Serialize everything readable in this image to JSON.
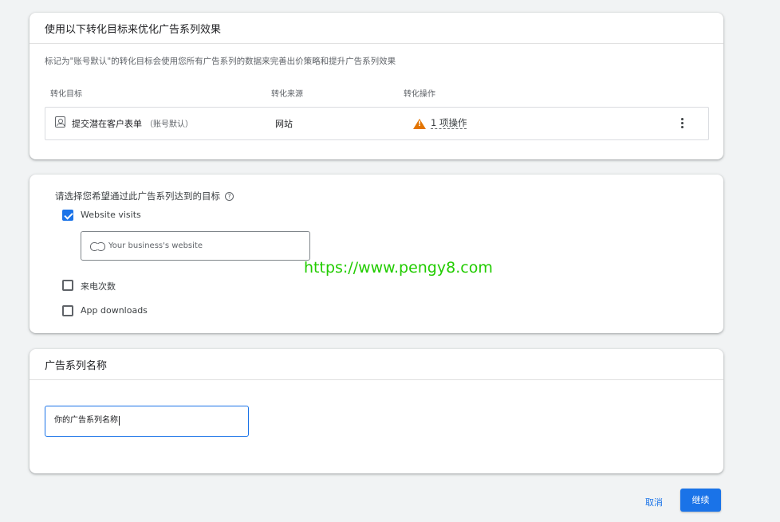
{
  "conversion_card": {
    "title": "使用以下转化目标来优化广告系列效果",
    "description": "标记为\"账号默认\"的转化目标会使用您所有广告系列的数据来完善出价策略和提升广告系列效果",
    "headers": [
      "转化目标",
      "转化来源",
      "转化操作"
    ],
    "row": {
      "goal": "提交潜在客户表单",
      "goal_tag": "（账号默认）",
      "source": "网站",
      "action": "1 项操作",
      "icon": "form-icon"
    }
  },
  "goals_card": {
    "question": "请选择您希望通过此广告系列达到的目标",
    "options": [
      {
        "label": "Website visits",
        "checked": true
      },
      {
        "label": "来电次数",
        "checked": false
      },
      {
        "label": "App downloads",
        "checked": false
      }
    ],
    "website_placeholder": "Your business's website"
  },
  "watermark": "https://www.pengy8.com",
  "name_card": {
    "title": "广告系列名称",
    "value": "你的广告系列名称"
  },
  "footer": {
    "cancel": "取消",
    "continue": "继续"
  },
  "colors": {
    "accent": "#1a73e8",
    "warning": "#e37400",
    "watermark": "#22cc00"
  }
}
